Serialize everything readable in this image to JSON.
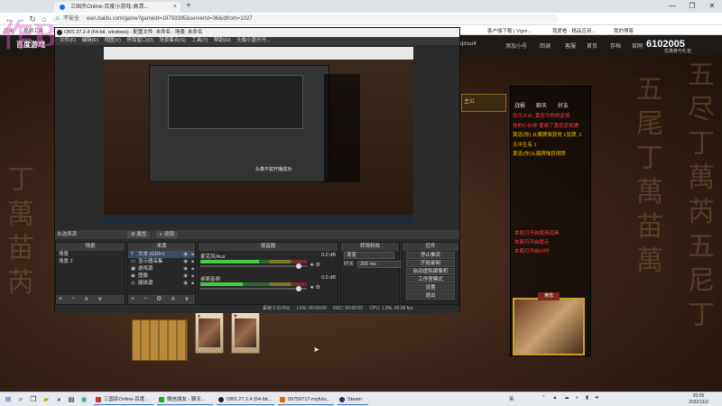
{
  "browser": {
    "tabs": [
      {
        "label": "三国杀Online-百度小游戏-高清...",
        "active": true
      }
    ],
    "new_tab_symbol": "+",
    "window_controls": [
      "—",
      "❐",
      "✕"
    ],
    "back_symbol": "←",
    "forward_symbol": "→",
    "reload_symbol": "↻",
    "home_symbol": "⌂",
    "security_label": "不安全",
    "url": "wan.baidu.com/game?gameId=19793395&serverId=36&idfrom=1027",
    "bookmarks": [
      "应用",
      "视频工具",
      "客户端下载 | Vigor...",
      "我爱看 - 精品应用...",
      "我的博客"
    ]
  },
  "game_header": {
    "logo": "百度游戏",
    "items": [
      "qinsu4",
      "添加小号",
      "回调",
      "客服",
      "首页",
      "存档",
      "官网",
      "优惠券与礼包"
    ],
    "number": "6102005"
  },
  "game": {
    "calligraphy_right": [
      "五",
      "尽",
      "丁",
      "萬",
      "芮",
      "五",
      "尼",
      "丁"
    ],
    "calligraphy_right2": [
      "五",
      "尾",
      "丁",
      "萬",
      "苗",
      "萬"
    ],
    "calligraphy_left": [
      "丁",
      "萬",
      "苗",
      "芮"
    ],
    "watermark": "作B",
    "side_tag": "主公",
    "panel_tabs": [
      "战报",
      "聊天",
      "好友"
    ],
    "log_lines": [
      {
        "text": "白马义从, 黄忠为你的武将",
        "cls": "r"
      },
      {
        "text": "你的小伙伴 使用了黄忠武将牌",
        "cls": "r"
      },
      {
        "text": "黄忠(你) 从摸牌堆获得 1张牌, 1",
        "cls": "y"
      },
      {
        "text": "无中生有 1",
        "cls": "y"
      },
      {
        "text": "黄忠(你)从摸牌堆获得牌",
        "cls": "y"
      }
    ],
    "log_lines2": [
      "本局可开启使用道具",
      "本局可开启提示",
      "本局可开启计时"
    ],
    "general_name": "黄忠",
    "card_suits": [
      "♦",
      "♥"
    ]
  },
  "obs": {
    "title": "OBS 27.2.4 (64-bit, windows) - 配置文件: 未命名 - 场景: 未命名",
    "menu": [
      "文件(F)",
      "编辑(E)",
      "视图(V)",
      "停靠窗口(D)",
      "场景集合(S)",
      "工具(T)",
      "帮助(H)",
      "头像小惠开开..."
    ],
    "preview_caption": "头像不如开播成功",
    "no_source_selected": "未选择源",
    "props_button": "属性",
    "filters_button": "滤镜",
    "docks": {
      "scenes": {
        "title": "场景",
        "items": [
          "场景",
          "场景 2"
        ]
      },
      "sources": {
        "title": "来源",
        "items": [
          {
            "icon": "T",
            "label": "文本 (GDI+)"
          },
          {
            "icon": "▭",
            "label": "显示器采集"
          },
          {
            "icon": "▣",
            "label": "游戏源"
          },
          {
            "icon": "◉",
            "label": "图像"
          },
          {
            "icon": "◎",
            "label": "媒体源"
          }
        ]
      },
      "mixer": {
        "title": "混音器",
        "channels": [
          {
            "name": "麦克风/Aux",
            "db": "0.0 dB",
            "level": 0.55,
            "volume": 0.95
          },
          {
            "name": "桌面音频",
            "db": "0.0 dB",
            "level": 0.4,
            "volume": 0.95
          }
        ]
      },
      "transitions": {
        "title": "转场特效",
        "type": "渐变",
        "duration_label": "时长",
        "duration": "300 ms"
      },
      "controls": {
        "title": "控件",
        "buttons": [
          "停止推流",
          "开始录制",
          "启动虚拟摄像机",
          "工作室模式",
          "设置",
          "退出"
        ]
      }
    },
    "status": {
      "dropped": "丢帧 0 (0.0%)",
      "live": "LIVE: 00:00:00",
      "rec": "REC: 00:00:00",
      "cpu": "CPU: 1.9%, 60.00 fps"
    }
  },
  "taskbar": {
    "apps": [
      {
        "label": "三国杀Online-百度..."
      },
      {
        "label": "微信朋友 - 聊天..."
      },
      {
        "label": "OBS 27.2.4 (64-bit..."
      },
      {
        "label": "09759717-myfulu..."
      },
      {
        "label": "Steam"
      }
    ],
    "tray_lang": "英",
    "time": "20:05",
    "date": "2022/11/2"
  },
  "colors": {
    "chrome_bg": "#dee1e6",
    "obs_bg": "#2b2b2b",
    "log_yellow": "#f0c000",
    "log_red": "#ff4444"
  }
}
